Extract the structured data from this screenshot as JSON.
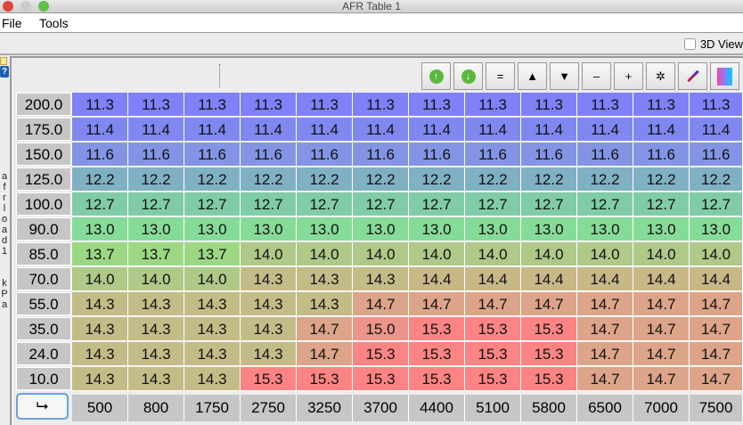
{
  "window": {
    "title": "AFR Table 1"
  },
  "menu": [
    "File",
    "Tools"
  ],
  "view_3d": {
    "label": "3D View",
    "checked": false
  },
  "axis_label": "afrload1 kPa",
  "corner_icon": "swap-axes-icon",
  "toolbar": [
    {
      "name": "increment-button",
      "icon": "arrow-up-circle-icon",
      "glyph": ""
    },
    {
      "name": "decrement-button",
      "icon": "arrow-down-circle-icon",
      "glyph": ""
    },
    {
      "name": "set-equal-button",
      "icon": "equals-icon",
      "glyph": "="
    },
    {
      "name": "increase-button",
      "icon": "triangle-up-icon",
      "glyph": "▲"
    },
    {
      "name": "decrease-button",
      "icon": "triangle-down-icon",
      "glyph": "▼"
    },
    {
      "name": "subtract-button",
      "icon": "minus-icon",
      "glyph": "–"
    },
    {
      "name": "add-button",
      "icon": "plus-icon",
      "glyph": "+"
    },
    {
      "name": "multiply-button",
      "icon": "asterisk-icon",
      "glyph": "✲"
    },
    {
      "name": "interpolate-button",
      "icon": "pencil-icon",
      "glyph": ""
    },
    {
      "name": "color-map-button",
      "icon": "gradient-icon",
      "glyph": ""
    }
  ],
  "table": {
    "rpm": [
      "500",
      "800",
      "1750",
      "2750",
      "3250",
      "3700",
      "4400",
      "5100",
      "5800",
      "6500",
      "7000",
      "7500"
    ],
    "load": [
      "200.0",
      "175.0",
      "150.0",
      "125.0",
      "100.0",
      "90.0",
      "85.0",
      "70.0",
      "55.0",
      "35.0",
      "24.0",
      "10.0"
    ],
    "values": [
      [
        "11.3",
        "11.3",
        "11.3",
        "11.3",
        "11.3",
        "11.3",
        "11.3",
        "11.3",
        "11.3",
        "11.3",
        "11.3",
        "11.3"
      ],
      [
        "11.4",
        "11.4",
        "11.4",
        "11.4",
        "11.4",
        "11.4",
        "11.4",
        "11.4",
        "11.4",
        "11.4",
        "11.4",
        "11.4"
      ],
      [
        "11.6",
        "11.6",
        "11.6",
        "11.6",
        "11.6",
        "11.6",
        "11.6",
        "11.6",
        "11.6",
        "11.6",
        "11.6",
        "11.6"
      ],
      [
        "12.2",
        "12.2",
        "12.2",
        "12.2",
        "12.2",
        "12.2",
        "12.2",
        "12.2",
        "12.2",
        "12.2",
        "12.2",
        "12.2"
      ],
      [
        "12.7",
        "12.7",
        "12.7",
        "12.7",
        "12.7",
        "12.7",
        "12.7",
        "12.7",
        "12.7",
        "12.7",
        "12.7",
        "12.7"
      ],
      [
        "13.0",
        "13.0",
        "13.0",
        "13.0",
        "13.0",
        "13.0",
        "13.0",
        "13.0",
        "13.0",
        "13.0",
        "13.0",
        "13.0"
      ],
      [
        "13.7",
        "13.7",
        "13.7",
        "14.0",
        "14.0",
        "14.0",
        "14.0",
        "14.0",
        "14.0",
        "14.0",
        "14.0",
        "14.0"
      ],
      [
        "14.0",
        "14.0",
        "14.0",
        "14.3",
        "14.3",
        "14.3",
        "14.4",
        "14.4",
        "14.4",
        "14.4",
        "14.4",
        "14.4"
      ],
      [
        "14.3",
        "14.3",
        "14.3",
        "14.3",
        "14.3",
        "14.7",
        "14.7",
        "14.7",
        "14.7",
        "14.7",
        "14.7",
        "14.7"
      ],
      [
        "14.3",
        "14.3",
        "14.3",
        "14.3",
        "14.7",
        "15.0",
        "15.3",
        "15.3",
        "15.3",
        "14.7",
        "14.7",
        "14.7"
      ],
      [
        "14.3",
        "14.3",
        "14.3",
        "14.3",
        "14.7",
        "15.3",
        "15.3",
        "15.3",
        "15.3",
        "14.7",
        "14.7",
        "14.7"
      ],
      [
        "14.3",
        "14.3",
        "14.3",
        "15.3",
        "15.3",
        "15.3",
        "15.3",
        "15.3",
        "15.3",
        "14.7",
        "14.7",
        "14.7"
      ]
    ]
  },
  "colors": {
    "11.3": "#8080f8",
    "11.4": "#8088f0",
    "11.6": "#8494e4",
    "12.2": "#80b0c4",
    "12.7": "#80cca8",
    "13.0": "#84dc98",
    "13.7": "#9cd884",
    "14.0": "#b0c888",
    "14.3": "#c4bc88",
    "14.4": "#c8b888",
    "14.7": "#dca488",
    "15.0": "#ec9488",
    "15.3": "#fc8484"
  }
}
